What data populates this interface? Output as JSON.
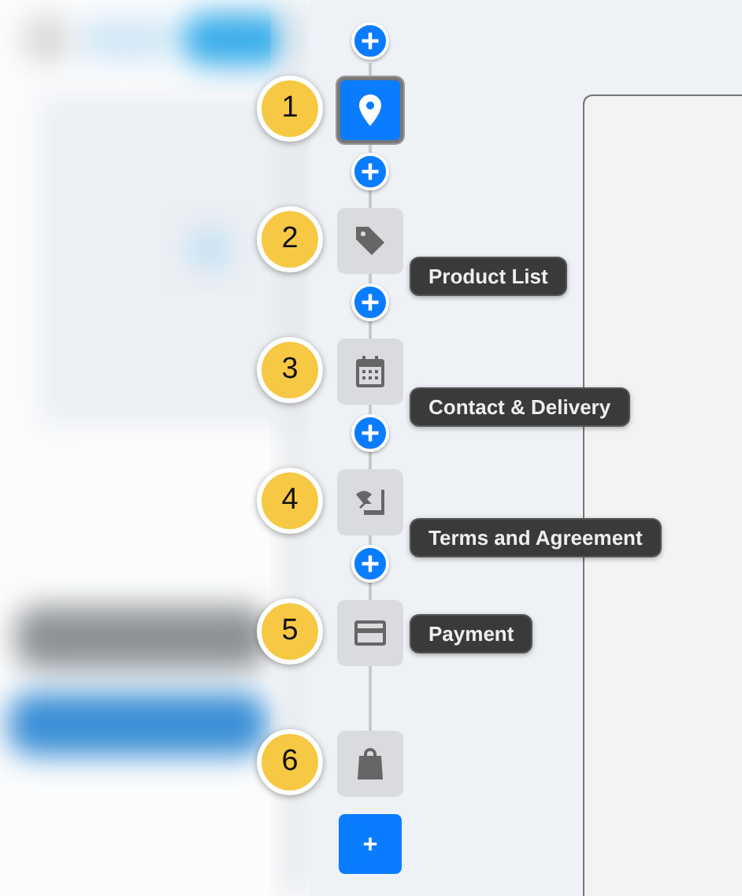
{
  "steps": [
    {
      "number": "1",
      "kind": "pin",
      "selected": true,
      "insert_before": true
    },
    {
      "number": "2",
      "kind": "tag",
      "selected": false,
      "insert_before": true,
      "label": "Product List"
    },
    {
      "number": "3",
      "kind": "calendar",
      "selected": false,
      "insert_before": true,
      "label": "Contact & Delivery"
    },
    {
      "number": "4",
      "kind": "sign",
      "selected": false,
      "insert_before": true,
      "label": "Terms and Agreement"
    },
    {
      "number": "5",
      "kind": "card",
      "selected": false,
      "insert_before": true,
      "label": "Payment"
    },
    {
      "number": "6",
      "kind": "bag",
      "selected": false,
      "insert_before": false
    }
  ]
}
